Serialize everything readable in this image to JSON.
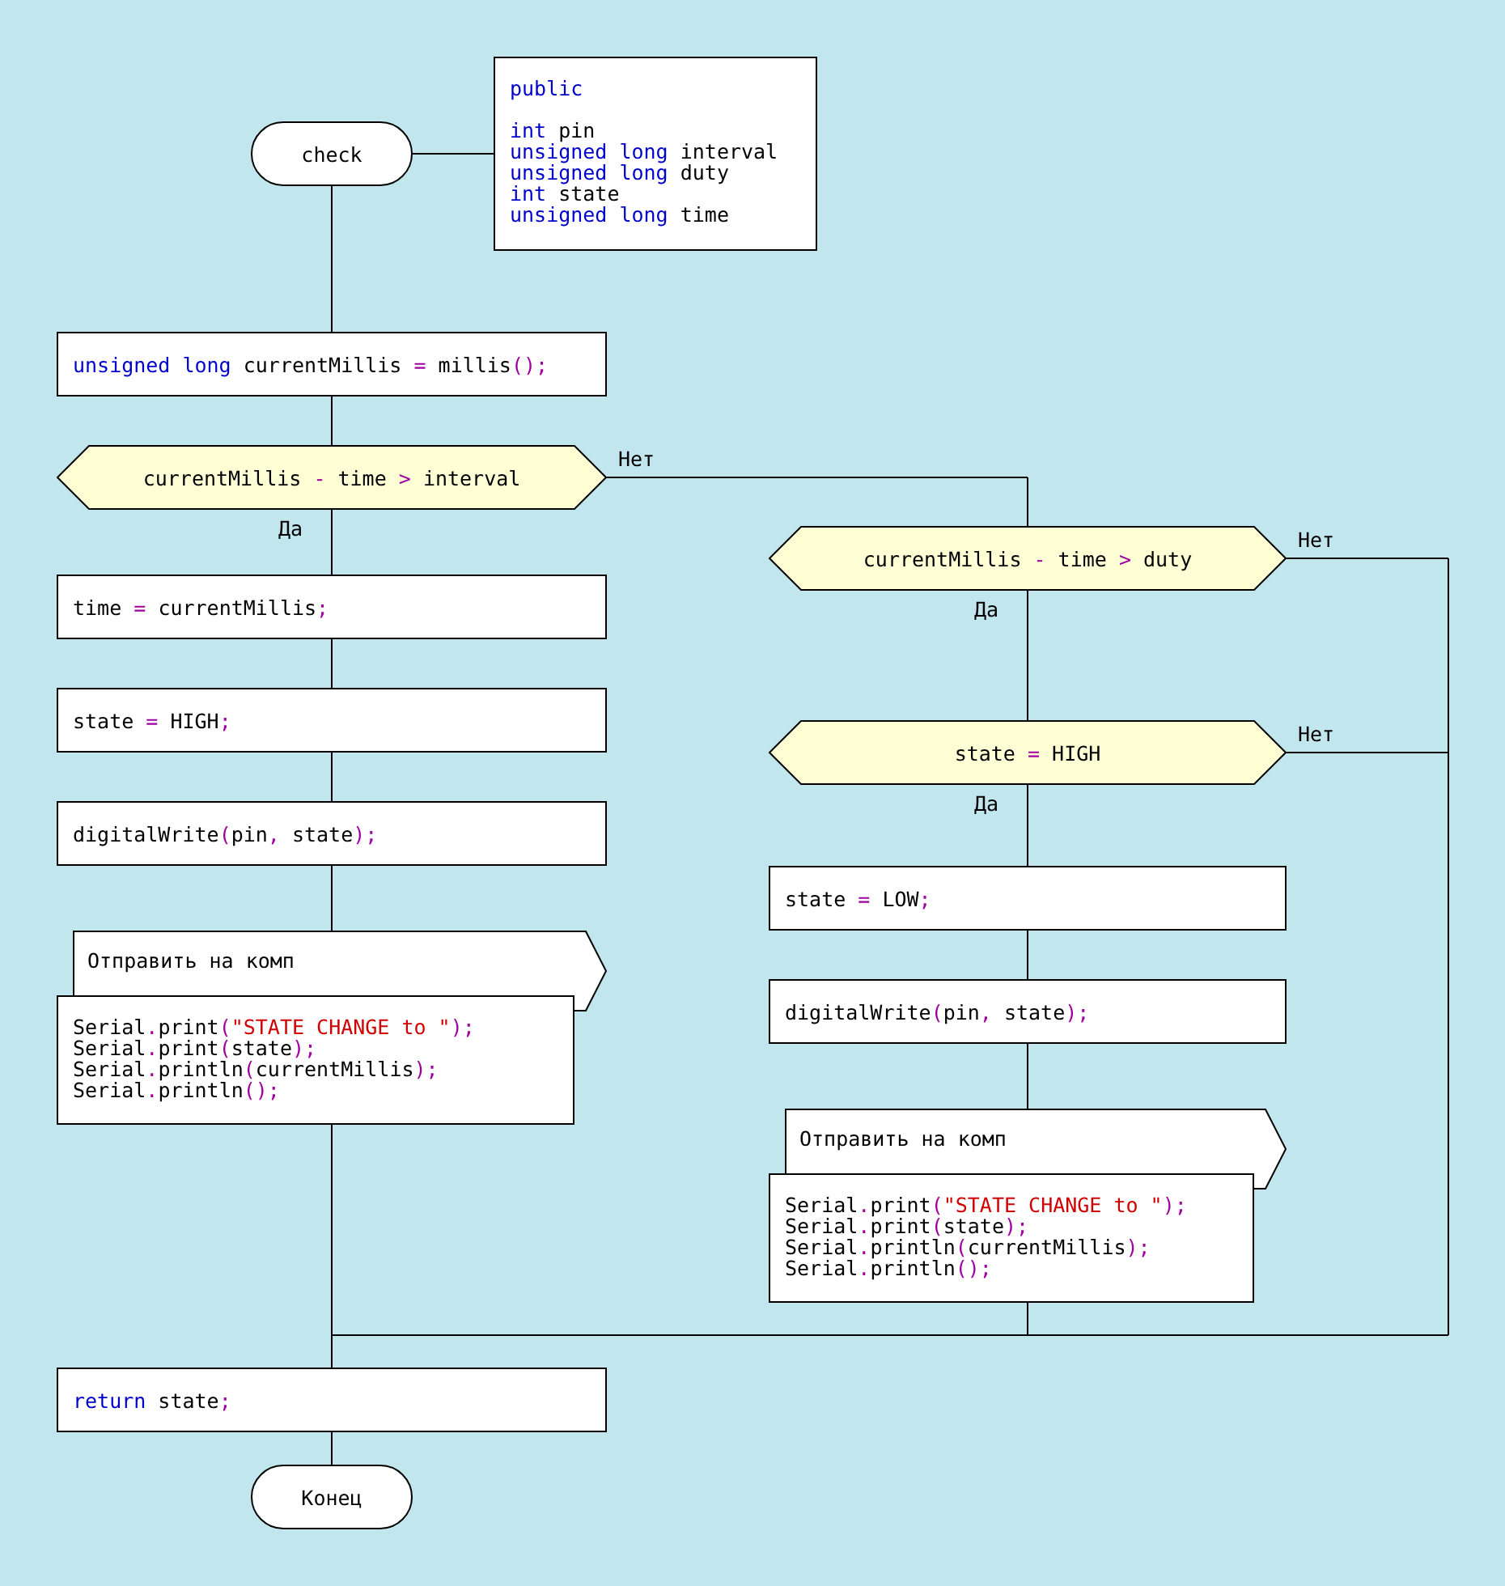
{
  "diagram": {
    "nodes": [
      {
        "kind": "terminal",
        "label": "check"
      },
      {
        "kind": "params",
        "header": [
          {
            "text": "public",
            "kind": "keyword"
          }
        ],
        "lines": [
          [
            {
              "text": "int",
              "kind": "keyword"
            },
            {
              "text": " pin",
              "kind": "plain"
            }
          ],
          [
            {
              "text": "unsigned long",
              "kind": "keyword"
            },
            {
              "text": " interval",
              "kind": "plain"
            }
          ],
          [
            {
              "text": "unsigned long",
              "kind": "keyword"
            },
            {
              "text": " duty",
              "kind": "plain"
            }
          ],
          [
            {
              "text": "int",
              "kind": "keyword"
            },
            {
              "text": " state",
              "kind": "plain"
            }
          ],
          [
            {
              "text": "unsigned long",
              "kind": "keyword"
            },
            {
              "text": " time",
              "kind": "plain"
            }
          ]
        ]
      },
      {
        "kind": "action",
        "lines": [
          [
            {
              "text": "unsigned long",
              "kind": "keyword"
            },
            {
              "text": " currentMillis ",
              "kind": "plain"
            },
            {
              "text": "=",
              "kind": "operator"
            },
            {
              "text": " millis",
              "kind": "plain"
            },
            {
              "text": "();",
              "kind": "operator"
            }
          ]
        ]
      },
      {
        "kind": "question",
        "yes": "Да",
        "no": "Нет",
        "line": [
          {
            "text": "currentMillis ",
            "kind": "plain"
          },
          {
            "text": "-",
            "kind": "operator"
          },
          {
            "text": " time ",
            "kind": "plain"
          },
          {
            "text": ">",
            "kind": "operator"
          },
          {
            "text": " interval",
            "kind": "plain"
          }
        ]
      },
      {
        "kind": "action",
        "lines": [
          [
            {
              "text": "time ",
              "kind": "plain"
            },
            {
              "text": "=",
              "kind": "operator"
            },
            {
              "text": " currentMillis",
              "kind": "plain"
            },
            {
              "text": ";",
              "kind": "operator"
            }
          ]
        ]
      },
      {
        "kind": "action",
        "lines": [
          [
            {
              "text": "state ",
              "kind": "plain"
            },
            {
              "text": "=",
              "kind": "operator"
            },
            {
              "text": " HIGH",
              "kind": "plain"
            },
            {
              "text": ";",
              "kind": "operator"
            }
          ]
        ]
      },
      {
        "kind": "action",
        "lines": [
          [
            {
              "text": "digitalWrite",
              "kind": "plain"
            },
            {
              "text": "(",
              "kind": "operator"
            },
            {
              "text": "pin",
              "kind": "plain"
            },
            {
              "text": ",",
              "kind": "operator"
            },
            {
              "text": " state",
              "kind": "plain"
            },
            {
              "text": ");",
              "kind": "operator"
            }
          ]
        ]
      },
      {
        "kind": "output",
        "title": "Отправить на комп",
        "lines": [
          [
            {
              "text": "Serial",
              "kind": "plain"
            },
            {
              "text": ".",
              "kind": "operator"
            },
            {
              "text": "print",
              "kind": "plain"
            },
            {
              "text": "(",
              "kind": "operator"
            },
            {
              "text": "\"STATE CHANGE to \"",
              "kind": "string"
            },
            {
              "text": ");",
              "kind": "operator"
            }
          ],
          [
            {
              "text": "Serial",
              "kind": "plain"
            },
            {
              "text": ".",
              "kind": "operator"
            },
            {
              "text": "print",
              "kind": "plain"
            },
            {
              "text": "(",
              "kind": "operator"
            },
            {
              "text": "state",
              "kind": "plain"
            },
            {
              "text": ");",
              "kind": "operator"
            }
          ],
          [
            {
              "text": "Serial",
              "kind": "plain"
            },
            {
              "text": ".",
              "kind": "operator"
            },
            {
              "text": "println",
              "kind": "plain"
            },
            {
              "text": "(",
              "kind": "operator"
            },
            {
              "text": "currentMillis",
              "kind": "plain"
            },
            {
              "text": ");",
              "kind": "operator"
            }
          ],
          [
            {
              "text": "Serial",
              "kind": "plain"
            },
            {
              "text": ".",
              "kind": "operator"
            },
            {
              "text": "println",
              "kind": "plain"
            },
            {
              "text": "();",
              "kind": "operator"
            }
          ]
        ]
      },
      {
        "kind": "question",
        "yes": "Да",
        "no": "Нет",
        "line": [
          {
            "text": "currentMillis ",
            "kind": "plain"
          },
          {
            "text": "-",
            "kind": "operator"
          },
          {
            "text": " time ",
            "kind": "plain"
          },
          {
            "text": ">",
            "kind": "operator"
          },
          {
            "text": " duty",
            "kind": "plain"
          }
        ]
      },
      {
        "kind": "question",
        "yes": "Да",
        "no": "Нет",
        "line": [
          {
            "text": "state ",
            "kind": "plain"
          },
          {
            "text": "=",
            "kind": "operator"
          },
          {
            "text": " HIGH",
            "kind": "plain"
          }
        ]
      },
      {
        "kind": "action",
        "lines": [
          [
            {
              "text": "state ",
              "kind": "plain"
            },
            {
              "text": "=",
              "kind": "operator"
            },
            {
              "text": " LOW",
              "kind": "plain"
            },
            {
              "text": ";",
              "kind": "operator"
            }
          ]
        ]
      },
      {
        "kind": "action",
        "lines": [
          [
            {
              "text": "digitalWrite",
              "kind": "plain"
            },
            {
              "text": "(",
              "kind": "operator"
            },
            {
              "text": "pin",
              "kind": "plain"
            },
            {
              "text": ",",
              "kind": "operator"
            },
            {
              "text": " state",
              "kind": "plain"
            },
            {
              "text": ");",
              "kind": "operator"
            }
          ]
        ]
      },
      {
        "kind": "output",
        "title": "Отправить на комп",
        "lines": [
          [
            {
              "text": "Serial",
              "kind": "plain"
            },
            {
              "text": ".",
              "kind": "operator"
            },
            {
              "text": "print",
              "kind": "plain"
            },
            {
              "text": "(",
              "kind": "operator"
            },
            {
              "text": "\"STATE CHANGE to \"",
              "kind": "string"
            },
            {
              "text": ");",
              "kind": "operator"
            }
          ],
          [
            {
              "text": "Serial",
              "kind": "plain"
            },
            {
              "text": ".",
              "kind": "operator"
            },
            {
              "text": "print",
              "kind": "plain"
            },
            {
              "text": "(",
              "kind": "operator"
            },
            {
              "text": "state",
              "kind": "plain"
            },
            {
              "text": ");",
              "kind": "operator"
            }
          ],
          [
            {
              "text": "Serial",
              "kind": "plain"
            },
            {
              "text": ".",
              "kind": "operator"
            },
            {
              "text": "println",
              "kind": "plain"
            },
            {
              "text": "(",
              "kind": "operator"
            },
            {
              "text": "currentMillis",
              "kind": "plain"
            },
            {
              "text": ");",
              "kind": "operator"
            }
          ],
          [
            {
              "text": "Serial",
              "kind": "plain"
            },
            {
              "text": ".",
              "kind": "operator"
            },
            {
              "text": "println",
              "kind": "plain"
            },
            {
              "text": "();",
              "kind": "operator"
            }
          ]
        ]
      },
      {
        "kind": "action",
        "lines": [
          [
            {
              "text": "return",
              "kind": "keyword"
            },
            {
              "text": " state",
              "kind": "plain"
            },
            {
              "text": ";",
              "kind": "operator"
            }
          ]
        ]
      },
      {
        "kind": "terminal",
        "label": "Конец"
      }
    ]
  }
}
